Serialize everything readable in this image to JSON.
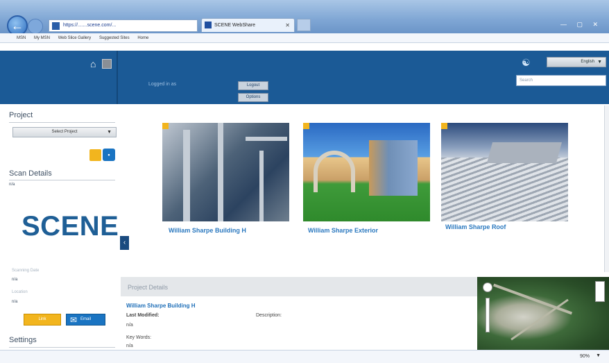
{
  "browser": {
    "address": "https://.......scene.com/...",
    "tab_title": "SCENE WebShare",
    "favorites": [
      "MSN",
      "My MSN",
      "Web Slice Gallery",
      "Suggested Sites",
      "Home"
    ],
    "window_controls": "— ▢ ✕",
    "zoom": "90%"
  },
  "header": {
    "logged_in_text": "Logged in as",
    "button_1": "Logout",
    "button_2": "Options",
    "language": "English",
    "search_placeholder": "Search"
  },
  "sidebar": {
    "project_heading": "Project",
    "select_project": "Select Project",
    "scan_details_heading": "Scan Details",
    "scan_details_value": "n/a",
    "logo_text": "SCENE",
    "scanning_date_label": "Scanning Date",
    "scanning_date_value": "n/a",
    "location_label": "Location",
    "location_value": "n/a",
    "btn_yellow": "Link",
    "btn_blue": "Email",
    "settings_heading": "Settings"
  },
  "scans": [
    {
      "label": "William Sharpe Building H"
    },
    {
      "label": "William Sharpe Exterior"
    },
    {
      "label": "William Sharpe Roof"
    }
  ],
  "project_details": {
    "title": "Project Details",
    "name": "William Sharpe Building H",
    "last_modified_label": "Last Modified:",
    "last_modified_value": "n/a",
    "description_label": "Description:",
    "keywords_label": "Key Words:",
    "keywords_value": "n/a"
  }
}
